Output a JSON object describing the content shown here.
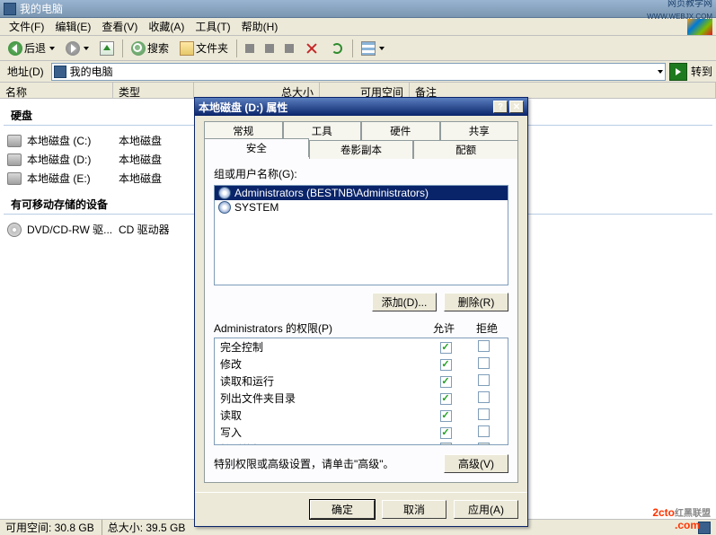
{
  "titlebar": {
    "title": "我的电脑",
    "corner": "网页教学网",
    "corner2": "WWW.WEBJX.COM"
  },
  "menu": {
    "file": "文件(F)",
    "edit": "编辑(E)",
    "view": "查看(V)",
    "favorites": "收藏(A)",
    "tools": "工具(T)",
    "help": "帮助(H)"
  },
  "toolbar": {
    "back": "后退",
    "search": "搜索",
    "folders": "文件夹"
  },
  "address": {
    "label": "地址(D)",
    "value": "我的电脑",
    "go": "转到"
  },
  "columns": {
    "name": "名称",
    "type": "类型",
    "totalsize": "总大小",
    "free": "可用空间",
    "note": "备注"
  },
  "groups": {
    "hdd": "硬盘",
    "removable": "有可移动存储的设备"
  },
  "drives": [
    {
      "name": "本地磁盘 (C:)",
      "type": "本地磁盘"
    },
    {
      "name": "本地磁盘 (D:)",
      "type": "本地磁盘"
    },
    {
      "name": "本地磁盘 (E:)",
      "type": "本地磁盘"
    }
  ],
  "optical": {
    "name": "DVD/CD-RW 驱...",
    "type": "CD 驱动器"
  },
  "status": {
    "free": "可用空间: 30.8 GB",
    "total": "总大小: 39.5 GB"
  },
  "dialog": {
    "title": "本地磁盘 (D:) 属性",
    "tabs_row1": [
      "常规",
      "工具",
      "硬件",
      "共享"
    ],
    "tabs_row2": [
      "安全",
      "卷影副本",
      "配额"
    ],
    "active_tab": "安全",
    "group_label": "组或用户名称(G):",
    "users": [
      {
        "name": "Administrators (BESTNB\\Administrators)",
        "selected": true
      },
      {
        "name": "SYSTEM",
        "selected": false
      }
    ],
    "add": "添加(D)...",
    "remove": "删除(R)",
    "perm_header": "Administrators 的权限(P)",
    "allow": "允许",
    "deny": "拒绝",
    "permissions": [
      {
        "name": "完全控制",
        "allow": true,
        "deny": false
      },
      {
        "name": "修改",
        "allow": true,
        "deny": false
      },
      {
        "name": "读取和运行",
        "allow": true,
        "deny": false
      },
      {
        "name": "列出文件夹目录",
        "allow": true,
        "deny": false
      },
      {
        "name": "读取",
        "allow": true,
        "deny": false
      },
      {
        "name": "写入",
        "allow": true,
        "deny": false
      },
      {
        "name": "特别的权限",
        "allow": false,
        "deny": false,
        "disabled": true
      }
    ],
    "advtext": "特别权限或高级设置，请单击\"高级\"。",
    "advanced": "高级(V)",
    "ok": "确定",
    "cancel": "取消",
    "apply": "应用(A)"
  },
  "watermark": {
    "big": "2cto",
    "tag": ".com",
    "sub": "红黑联盟"
  }
}
